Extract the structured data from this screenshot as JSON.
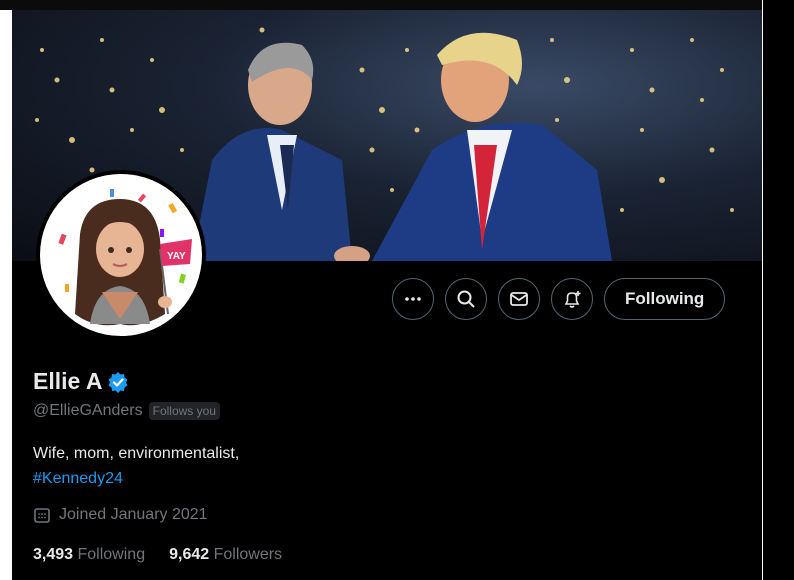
{
  "profile": {
    "name": "Ellie A",
    "handle": "@EllieGAnders",
    "follows_you": "Follows you",
    "bio_text": "Wife, mom, environmentalist,",
    "bio_hashtag": "#Kennedy24",
    "joined": "Joined January 2021",
    "following_count": "3,493",
    "following_label": "Following",
    "followers_count": "9,642",
    "followers_label": "Followers",
    "verified": true
  },
  "actions": {
    "more_icon": "more-icon",
    "search_icon": "search-icon",
    "message_icon": "mail-icon",
    "notify_icon": "bell-plus-icon",
    "follow_state_label": "Following"
  },
  "avatar": {
    "sign_text": "YAY"
  },
  "colors": {
    "background": "#000000",
    "text_primary": "#e7e9ea",
    "text_secondary": "#71767b",
    "accent": "#1d9bf0",
    "border": "#536471"
  }
}
